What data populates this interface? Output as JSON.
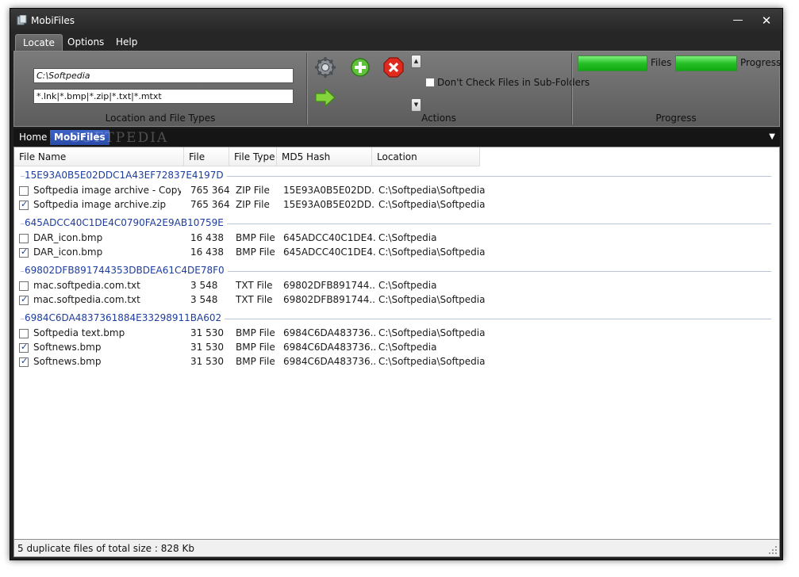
{
  "window": {
    "title": "MobiFiles",
    "minimize": "—",
    "close": "✕"
  },
  "menu": {
    "items": [
      "Locate",
      "Options",
      "Help"
    ]
  },
  "ribbon": {
    "location_group": {
      "path_value": "C:\\Softpedia",
      "types_value": "*.lnk|*.bmp|*.zip|*.txt|*.mtxt",
      "label": "Location and File Types"
    },
    "actions_group": {
      "label": "Actions",
      "subfolders_label": "Don't Check Files in Sub-Folders",
      "subfolders_checked": false
    },
    "progress_group": {
      "label": "Progress",
      "files_label": "Files",
      "progress_label": "Progress",
      "files_fraction": 1.0,
      "progress_fraction": 1.0
    }
  },
  "tabs": {
    "items": [
      "Home",
      "MobiFiles"
    ],
    "active": "MobiFiles",
    "watermark": "SOFTPEDIA",
    "watermark_url": "www.softpedia.com"
  },
  "list": {
    "columns": [
      "File Name",
      "File Siz...",
      "File Type",
      "MD5 Hash",
      "Location"
    ],
    "groups": [
      {
        "hash": "15E93A0B5E02DDC1A43EF72837E4197D",
        "files": [
          {
            "checked": false,
            "name": "Softpedia image archive - Copy.zip",
            "size": "765 364",
            "type": "ZIP File",
            "md5": "15E93A0B5E02DD...",
            "location": "C:\\Softpedia\\Softpedia"
          },
          {
            "checked": true,
            "name": "Softpedia image archive.zip",
            "size": "765 364",
            "type": "ZIP File",
            "md5": "15E93A0B5E02DD...",
            "location": "C:\\Softpedia\\Softpedia"
          }
        ]
      },
      {
        "hash": "645ADCC40C1DE4C0790FA2E9AB10759E",
        "files": [
          {
            "checked": false,
            "name": "DAR_icon.bmp",
            "size": "16 438",
            "type": "BMP File",
            "md5": "645ADCC40C1DE4...",
            "location": "C:\\Softpedia"
          },
          {
            "checked": true,
            "name": "DAR_icon.bmp",
            "size": "16 438",
            "type": "BMP File",
            "md5": "645ADCC40C1DE4...",
            "location": "C:\\Softpedia\\Softpedia"
          }
        ]
      },
      {
        "hash": "69802DFB891744353DBDEA61C4DE78F0",
        "files": [
          {
            "checked": false,
            "name": "mac.softpedia.com.txt",
            "size": "3 548",
            "type": "TXT File",
            "md5": "69802DFB891744...",
            "location": "C:\\Softpedia"
          },
          {
            "checked": true,
            "name": "mac.softpedia.com.txt",
            "size": "3 548",
            "type": "TXT File",
            "md5": "69802DFB891744...",
            "location": "C:\\Softpedia\\Softpedia"
          }
        ]
      },
      {
        "hash": "6984C6DA4837361884E33298911BA602",
        "files": [
          {
            "checked": false,
            "name": "Softpedia text.bmp",
            "size": "31 530",
            "type": "BMP File",
            "md5": "6984C6DA483736...",
            "location": "C:\\Softpedia\\Softpedia"
          },
          {
            "checked": true,
            "name": "Softnews.bmp",
            "size": "31 530",
            "type": "BMP File",
            "md5": "6984C6DA483736...",
            "location": "C:\\Softpedia"
          },
          {
            "checked": true,
            "name": "Softnews.bmp",
            "size": "31 530",
            "type": "BMP File",
            "md5": "6984C6DA483736...",
            "location": "C:\\Softpedia\\Softpedia"
          }
        ]
      }
    ]
  },
  "status": {
    "text": "5 duplicate files of total size : 828 Kb"
  },
  "colors": {
    "accent": "#2a4ba8",
    "group_title": "#1d3d9e",
    "progress_green": "#26c026"
  }
}
